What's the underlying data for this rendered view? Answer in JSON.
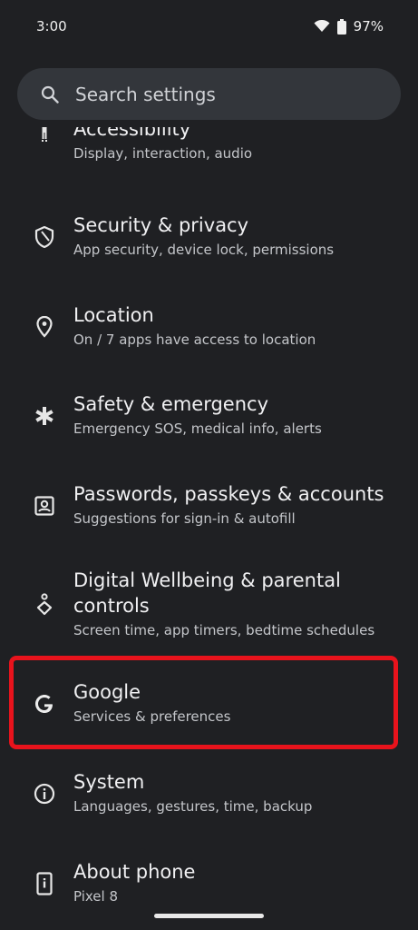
{
  "status_bar": {
    "time": "3:00",
    "battery": "97%"
  },
  "search": {
    "placeholder": "Search settings"
  },
  "items": [
    {
      "title": "Accessibility",
      "subtitle": "Display, interaction, audio",
      "icon": "accessibility-icon"
    },
    {
      "title": "Security & privacy",
      "subtitle": "App security, device lock, permissions",
      "icon": "shield-icon"
    },
    {
      "title": "Location",
      "subtitle": "On / 7 apps have access to location",
      "icon": "location-pin-icon"
    },
    {
      "title": "Safety & emergency",
      "subtitle": "Emergency SOS, medical info, alerts",
      "icon": "asterisk-icon"
    },
    {
      "title": "Passwords, passkeys & accounts",
      "subtitle": "Suggestions for sign-in & autofill",
      "icon": "account-box-icon"
    },
    {
      "title": "Digital Wellbeing & parental controls",
      "subtitle": "Screen time, app timers, bedtime schedules",
      "icon": "wellbeing-icon"
    },
    {
      "title": "Google",
      "subtitle": "Services & preferences",
      "icon": "google-g-icon"
    },
    {
      "title": "System",
      "subtitle": "Languages, gestures, time, backup",
      "icon": "info-icon"
    },
    {
      "title": "About phone",
      "subtitle": "Pixel 8",
      "icon": "phone-info-icon"
    }
  ],
  "highlight_color": "#e8131c"
}
